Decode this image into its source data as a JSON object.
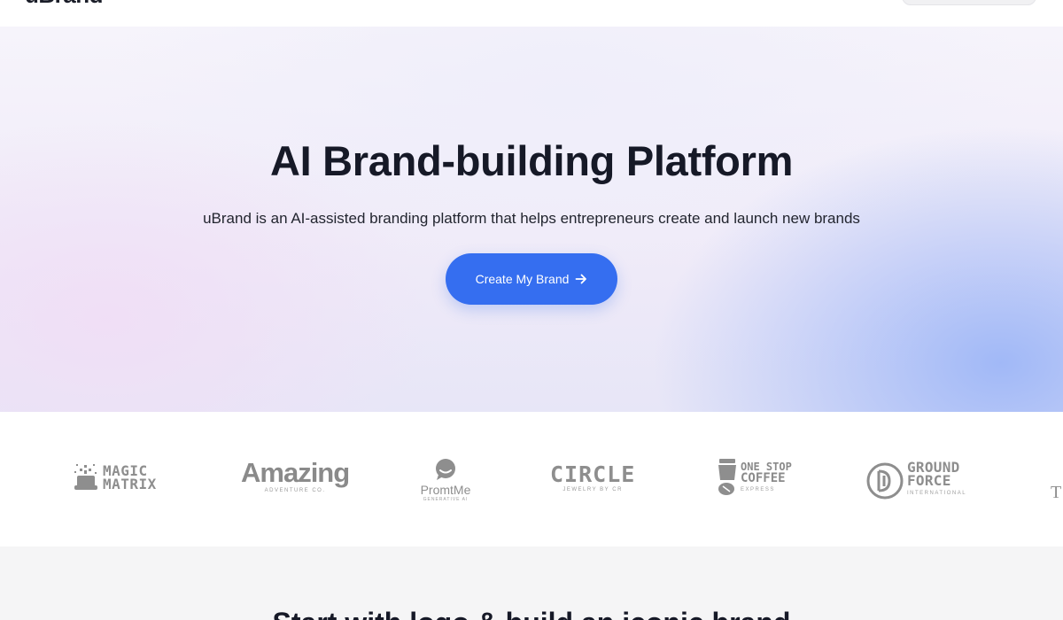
{
  "header": {
    "logo": "uBrand"
  },
  "hero": {
    "title": "AI Brand-building Platform",
    "subtitle": "uBrand is an AI-assisted branding platform that helps entrepreneurs create and launch new brands",
    "cta_label": "Create My Brand"
  },
  "logos": {
    "magic_matrix": {
      "line1": "MAGIC",
      "line2": "MATRIX"
    },
    "amazing": {
      "name": "Amazing",
      "tagline": "ADVENTURE CO."
    },
    "promptme": {
      "name": "PromtMe",
      "tagline": "GENERATIVE AI"
    },
    "circle": {
      "name": "CIRCLE",
      "tagline": "JEWELRY BY CR"
    },
    "coffee": {
      "line1": "ONE STOP",
      "line2": "COFFEE",
      "tagline": "EXPRESS"
    },
    "ground_force": {
      "line1": "GROUND",
      "line2": "FORCE",
      "tagline": "INTERNATIONAL"
    },
    "partial": "T"
  },
  "lower": {
    "title": "Start with logo & build an iconic brand"
  },
  "colors": {
    "accent": "#356ef0",
    "title_text": "#161927",
    "logo_gray": "#8e8e8e",
    "lower_bg": "#f5f5f6"
  }
}
